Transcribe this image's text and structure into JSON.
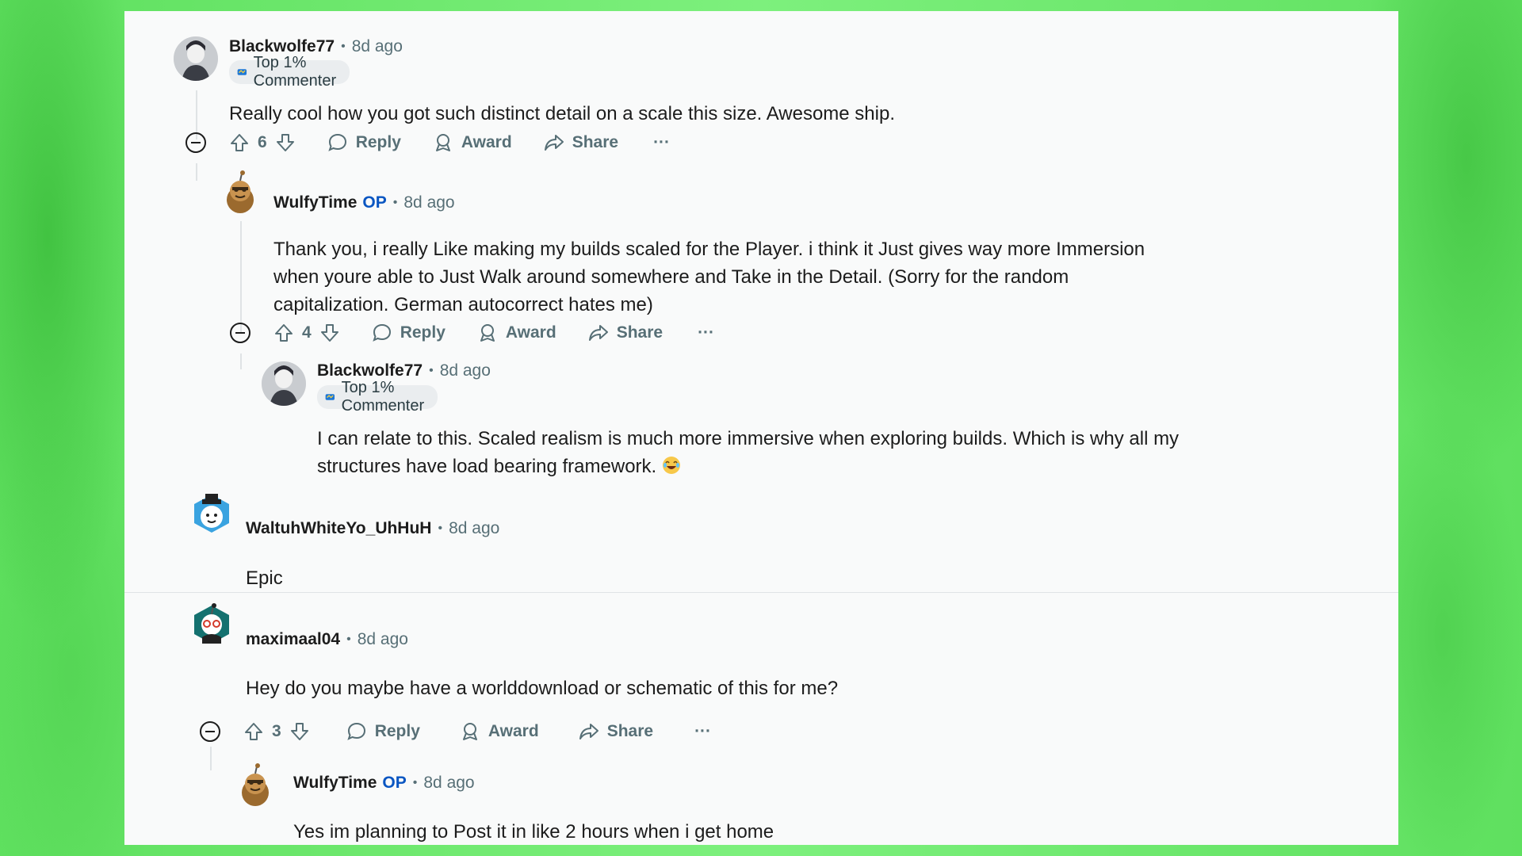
{
  "comments": [
    {
      "username": "Blackwolfe77",
      "time": "8d ago",
      "flair": "Top 1% Commenter",
      "body": "Really cool how you got such distinct detail on a scale this size. Awesome ship.",
      "score": "6",
      "avatar_icon": "user-avatar"
    },
    {
      "username": "WulfyTime",
      "op": "OP",
      "time": "8d ago",
      "body": "Thank you, i really Like making my builds scaled for the Player. i think it Just gives way more Immersion when youre able to Just Walk around somewhere and Take in the Detail. (Sorry for the random capitalization. German autocorrect hates me)",
      "score": "4",
      "avatar_icon": "snoo-avatar"
    },
    {
      "username": "Blackwolfe77",
      "time": "8d ago",
      "flair": "Top 1% Commenter",
      "body": "I can relate to this. Scaled realism is much more immersive when exploring builds. Which is why all my structures have load bearing framework.",
      "emoji": "laughing-emoji",
      "avatar_icon": "user-avatar"
    },
    {
      "username": "WaltuhWhiteYo_UhHuH",
      "time": "8d ago",
      "body": "Epic",
      "avatar_icon": "snoo-avatar"
    },
    {
      "username": "maximaal04",
      "time": "8d ago",
      "body": "Hey do you maybe have a worlddownload or schematic of this for me?",
      "score": "3",
      "avatar_icon": "snoo-avatar"
    },
    {
      "username": "WulfyTime",
      "op": "OP",
      "time": "8d ago",
      "body": "Yes im planning to Post it in like 2 hours when i get home",
      "avatar_icon": "snoo-avatar"
    }
  ],
  "actions": {
    "reply": "Reply",
    "award": "Award",
    "share": "Share",
    "more": "···"
  },
  "colors": {
    "background_green": "#6ee86e",
    "panel": "#f9fafa",
    "op_blue": "#0a56c2",
    "meta_gray": "#576f76"
  }
}
